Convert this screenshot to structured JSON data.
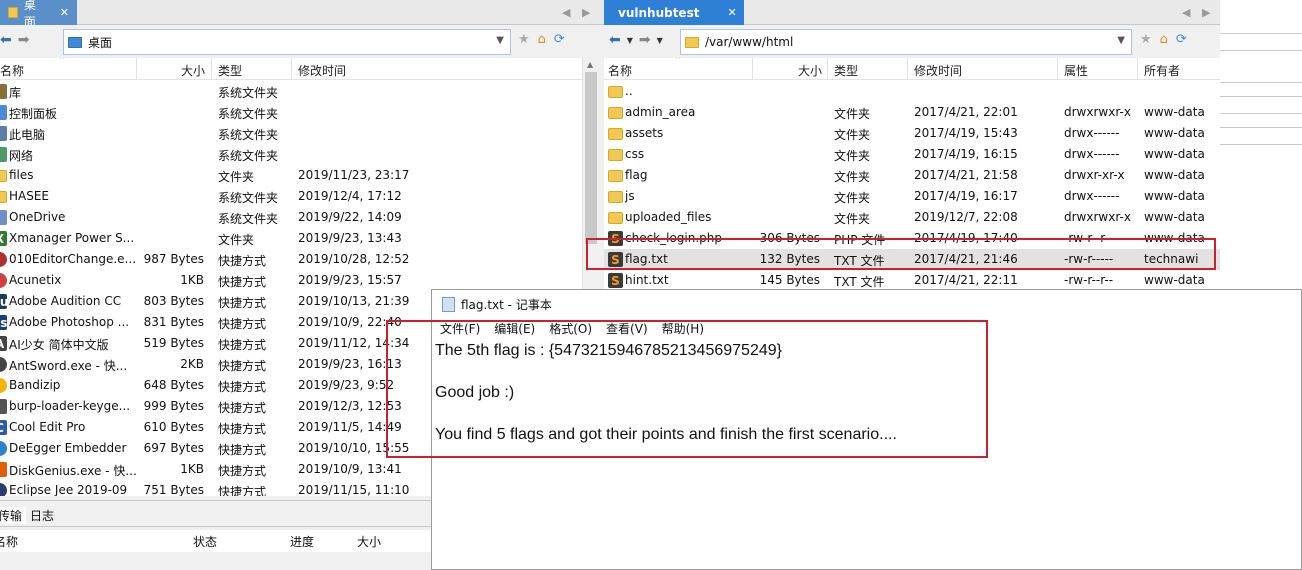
{
  "left": {
    "tab_label": "桌面",
    "address": "桌面",
    "columns": {
      "name": "名称",
      "size": "大小",
      "type": "类型",
      "modified": "修改时间"
    },
    "rows": [
      {
        "icon": "library-icon",
        "name": "库",
        "size": "",
        "type": "系统文件夹",
        "modified": ""
      },
      {
        "icon": "control-panel-icon",
        "name": "控制面板",
        "size": "",
        "type": "系统文件夹",
        "modified": ""
      },
      {
        "icon": "computer-icon",
        "name": "此电脑",
        "size": "",
        "type": "系统文件夹",
        "modified": ""
      },
      {
        "icon": "network-icon",
        "name": "网络",
        "size": "",
        "type": "系统文件夹",
        "modified": ""
      },
      {
        "icon": "folder-icon",
        "name": "files",
        "size": "",
        "type": "文件夹",
        "modified": "2019/11/23, 23:17"
      },
      {
        "icon": "folder-icon",
        "name": "HASEE",
        "size": "",
        "type": "系统文件夹",
        "modified": "2019/12/4, 17:12"
      },
      {
        "icon": "onedrive-icon",
        "name": "OneDrive",
        "size": "",
        "type": "系统文件夹",
        "modified": "2019/9/22, 14:09"
      },
      {
        "icon": "xmanager-icon",
        "name": "Xmanager Power S...",
        "size": "",
        "type": "文件夹",
        "modified": "2019/9/23, 13:43"
      },
      {
        "icon": "editor-icon",
        "name": "010EditorChange.e...",
        "size": "987 Bytes",
        "type": "快捷方式",
        "modified": "2019/10/28, 12:52"
      },
      {
        "icon": "acunetix-icon",
        "name": "Acunetix",
        "size": "1KB",
        "type": "快捷方式",
        "modified": "2019/9/23, 15:57"
      },
      {
        "icon": "audition-icon",
        "name": "Adobe Audition CC",
        "size": "803 Bytes",
        "type": "快捷方式",
        "modified": "2019/10/13, 21:39"
      },
      {
        "icon": "photoshop-icon",
        "name": "Adobe Photoshop ...",
        "size": "831 Bytes",
        "type": "快捷方式",
        "modified": "2019/10/9, 22:40"
      },
      {
        "icon": "ai-icon",
        "name": "AI少女 简体中文版",
        "size": "519 Bytes",
        "type": "快捷方式",
        "modified": "2019/11/12, 14:34"
      },
      {
        "icon": "antsword-icon",
        "name": "AntSword.exe - 快...",
        "size": "2KB",
        "type": "快捷方式",
        "modified": "2019/9/23, 16:13"
      },
      {
        "icon": "bandizip-icon",
        "name": "Bandizip",
        "size": "648 Bytes",
        "type": "快捷方式",
        "modified": "2019/9/23, 9:52"
      },
      {
        "icon": "burp-icon",
        "name": "burp-loader-keyge...",
        "size": "999 Bytes",
        "type": "快捷方式",
        "modified": "2019/12/3, 12:53"
      },
      {
        "icon": "cooledit-icon",
        "name": "Cool Edit Pro",
        "size": "610 Bytes",
        "type": "快捷方式",
        "modified": "2019/11/5, 14:49"
      },
      {
        "icon": "deegger-icon",
        "name": "DeEgger Embedder",
        "size": "697 Bytes",
        "type": "快捷方式",
        "modified": "2019/10/10, 15:55"
      },
      {
        "icon": "diskgenius-icon",
        "name": "DiskGenius.exe - 快...",
        "size": "1KB",
        "type": "快捷方式",
        "modified": "2019/10/9, 13:41"
      },
      {
        "icon": "eclipse-icon",
        "name": "Eclipse Jee 2019-09",
        "size": "751 Bytes",
        "type": "快捷方式",
        "modified": "2019/11/15, 11:10"
      }
    ]
  },
  "transfer": {
    "tabs": [
      "传输",
      "日志"
    ],
    "columns": {
      "name": "名称",
      "status": "状态",
      "progress": "进度",
      "size": "大小"
    }
  },
  "right": {
    "tab_label": "vulnhubtest",
    "address": "/var/www/html",
    "columns": {
      "name": "名称",
      "size": "大小",
      "type": "类型",
      "modified": "修改时间",
      "perm": "属性",
      "owner": "所有者"
    },
    "rows": [
      {
        "icon": "folder-icon",
        "name": "..",
        "size": "",
        "type": "",
        "modified": "",
        "perm": "",
        "owner": ""
      },
      {
        "icon": "folder-icon",
        "name": "admin_area",
        "size": "",
        "type": "文件夹",
        "modified": "2017/4/21, 22:01",
        "perm": "drwxrwxr-x",
        "owner": "www-data"
      },
      {
        "icon": "folder-icon",
        "name": "assets",
        "size": "",
        "type": "文件夹",
        "modified": "2017/4/19, 15:43",
        "perm": "drwx------",
        "owner": "www-data"
      },
      {
        "icon": "folder-icon",
        "name": "css",
        "size": "",
        "type": "文件夹",
        "modified": "2017/4/19, 16:15",
        "perm": "drwx------",
        "owner": "www-data"
      },
      {
        "icon": "folder-icon",
        "name": "flag",
        "size": "",
        "type": "文件夹",
        "modified": "2017/4/21, 21:58",
        "perm": "drwxr-xr-x",
        "owner": "www-data"
      },
      {
        "icon": "folder-icon",
        "name": "js",
        "size": "",
        "type": "文件夹",
        "modified": "2017/4/19, 16:17",
        "perm": "drwx------",
        "owner": "www-data"
      },
      {
        "icon": "folder-icon",
        "name": "uploaded_files",
        "size": "",
        "type": "文件夹",
        "modified": "2019/12/7, 22:08",
        "perm": "drwxrwxr-x",
        "owner": "www-data"
      },
      {
        "icon": "sublime-icon",
        "name": "check_login.php",
        "size": "306 Bytes",
        "type": "PHP 文件",
        "modified": "2017/4/19, 17:40",
        "perm": "-rw-r--r--",
        "owner": "www-data"
      },
      {
        "icon": "sublime-icon",
        "name": "flag.txt",
        "size": "132 Bytes",
        "type": "TXT 文件",
        "modified": "2017/4/21, 21:46",
        "perm": "-rw-r-----",
        "owner": "technawi"
      },
      {
        "icon": "sublime-icon",
        "name": "hint.txt",
        "size": "145 Bytes",
        "type": "TXT 文件",
        "modified": "2017/4/21, 22:11",
        "perm": "-rw-r--r--",
        "owner": "www-data"
      }
    ]
  },
  "notepad": {
    "title": "flag.txt - 记事本",
    "menu": [
      "文件(F)",
      "编辑(E)",
      "格式(O)",
      "查看(V)",
      "帮助(H)"
    ],
    "lines": [
      "The 5th flag is : {5473215946785213456975249}",
      "",
      "Good job :)",
      "",
      "You find 5 flags and got their points and finish the first scenario...."
    ]
  }
}
